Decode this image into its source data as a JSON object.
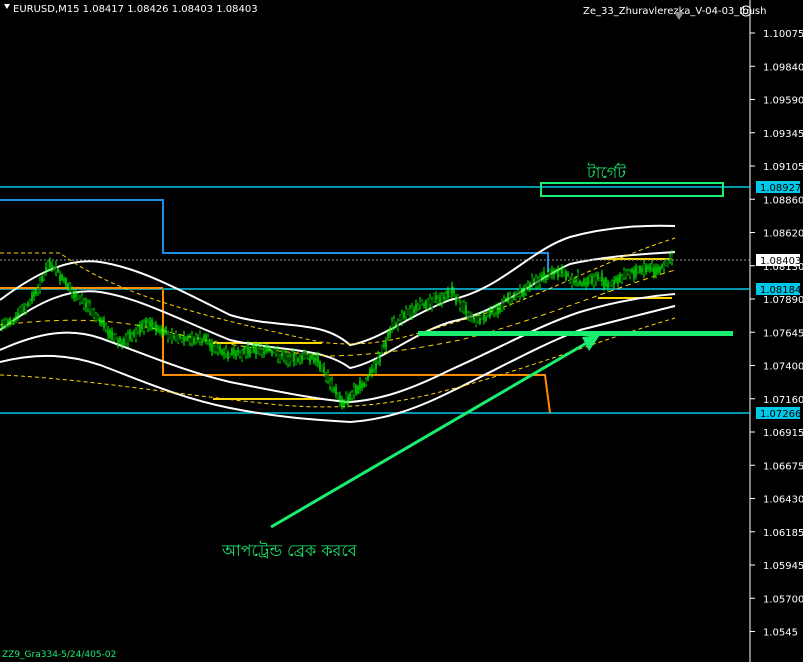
{
  "header": {
    "symbol_label": "EURUSD,M15  1.08417 1.08426 1.08403 1.08403",
    "template_label": "Ze_33_Zhuravlerezka_V-04-03_Ibush",
    "bottom_label": "ZZ9_Gra334-5/24/405-02"
  },
  "annotations": {
    "target": "টার্গেট",
    "breakout": "আপট্রেন্ড ব্রেক করবে"
  },
  "colors": {
    "background": "#000000",
    "axis_line": "#ffffff",
    "level_line": "#00c8e8",
    "band": "#ffffff",
    "channel_blue": "#1f8fe6",
    "channel_orange": "#ff8c00",
    "inner_band": "#ffd700",
    "candles": "#00ff00",
    "annotation": "#19ee70",
    "current_price_line": "#9a9a9a"
  },
  "chart_data": {
    "type": "candlestick",
    "symbol": "EURUSD",
    "timeframe": "M15",
    "ohlc_last": [
      1.08417,
      1.08426,
      1.08403,
      1.08403
    ],
    "ylim": [
      1.0556,
      1.111
    ],
    "y_ticks": [
      1.10075,
      1.0984,
      1.0959,
      1.09345,
      1.09105,
      1.0886,
      1.0862,
      1.0813,
      1.0789,
      1.07645,
      1.074,
      1.0716,
      1.06915,
      1.06675,
      1.0643,
      1.06185,
      1.05945,
      1.057,
      1.05455
    ],
    "tick_labels": [
      "1.10075",
      "1.09840",
      "1.09590",
      "1.09345",
      "1.09105",
      "1.08860",
      "1.08620",
      "1.08130",
      "1.07890",
      "1.07645",
      "1.07400",
      "1.07160",
      "1.06915",
      "1.06675",
      "1.06430",
      "1.06185",
      "1.05945",
      "1.05700",
      "1.0545"
    ],
    "levels": [
      {
        "value": 1.08927,
        "label": "1.08927"
      },
      {
        "value": 1.08184,
        "label": "1.08184"
      },
      {
        "value": 1.07266,
        "label": "1.07266"
      }
    ],
    "current_price": {
      "value": 1.08403,
      "label": "1.08403"
    },
    "series_close": [
      1.079,
      1.0797,
      1.0805,
      1.082,
      1.0838,
      1.0825,
      1.0812,
      1.0808,
      1.0796,
      1.0783,
      1.0779,
      1.0786,
      1.0793,
      1.0788,
      1.0784,
      1.078,
      1.0782,
      1.0779,
      1.0772,
      1.077,
      1.0772,
      1.0775,
      1.0773,
      1.0768,
      1.0767,
      1.0769,
      1.0765,
      1.0748,
      1.0735,
      1.0742,
      1.0752,
      1.0768,
      1.079,
      1.0798,
      1.0806,
      1.0808,
      1.0812,
      1.0816,
      1.0802,
      1.0796,
      1.0799,
      1.0807,
      1.0813,
      1.0819,
      1.0825,
      1.0829,
      1.083,
      1.0825,
      1.0823,
      1.0826,
      1.0821,
      1.0828,
      1.0831,
      1.0834,
      1.0833,
      1.084
    ]
  }
}
